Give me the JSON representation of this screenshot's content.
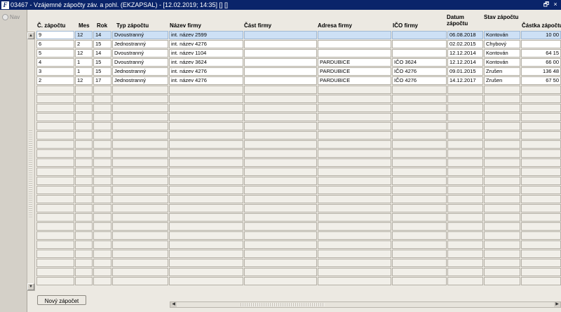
{
  "window": {
    "title": "03467 - Vzájemné zápočty záv. a pohl. (EKZAPSAL) - [12.02.2019; 14:35] [] []",
    "restore_glyph": "🗗",
    "close_glyph": "×"
  },
  "nav": {
    "label": "Nav"
  },
  "columns": [
    {
      "key": "zapocet",
      "label": "Č. zápočtu"
    },
    {
      "key": "mes",
      "label": "Mes"
    },
    {
      "key": "rok",
      "label": "Rok"
    },
    {
      "key": "typ",
      "label": "Typ zápočtu"
    },
    {
      "key": "nazev",
      "label": "Název firmy"
    },
    {
      "key": "cast",
      "label": "Část firmy"
    },
    {
      "key": "adresa",
      "label": "Adresa firmy"
    },
    {
      "key": "ico",
      "label": "IČO firmy"
    },
    {
      "key": "datum",
      "label": "Datum zápočtu"
    },
    {
      "key": "stav",
      "label": "Stav zápočtu"
    },
    {
      "key": "castka",
      "label": "Částka zápočtu"
    }
  ],
  "rows": [
    {
      "zapocet": "9",
      "mes": "12",
      "rok": "14",
      "typ": "Dvoustranný",
      "nazev": "int. název 2599",
      "cast": "",
      "adresa": "",
      "ico": "",
      "datum": "06.08.2018",
      "stav": "Kontován",
      "castka": "10 00"
    },
    {
      "zapocet": "6",
      "mes": "2",
      "rok": "15",
      "typ": "Jednostranný",
      "nazev": "int. název 4276",
      "cast": "",
      "adresa": "",
      "ico": "",
      "datum": "02.02.2015",
      "stav": "Chybový",
      "castka": ""
    },
    {
      "zapocet": "5",
      "mes": "12",
      "rok": "14",
      "typ": "Dvoustranný",
      "nazev": "int. název 1104",
      "cast": "",
      "adresa": "",
      "ico": "",
      "datum": "12.12.2014",
      "stav": "Kontován",
      "castka": "64 15"
    },
    {
      "zapocet": "4",
      "mes": "1",
      "rok": "15",
      "typ": "Dvoustranný",
      "nazev": "int. název 3624",
      "cast": "",
      "adresa": "PARDUBICE",
      "ico": "IČO 3624",
      "datum": "12.12.2014",
      "stav": "Kontován",
      "castka": "66 00"
    },
    {
      "zapocet": "3",
      "mes": "1",
      "rok": "15",
      "typ": "Jednostranný",
      "nazev": "int. název 4276",
      "cast": "",
      "adresa": "PARDUBICE",
      "ico": "IČO 4276",
      "datum": "09.01.2015",
      "stav": "Zrušen",
      "castka": "136 48"
    },
    {
      "zapocet": "2",
      "mes": "12",
      "rok": "17",
      "typ": "Jednostranný",
      "nazev": "int. název 4276",
      "cast": "",
      "adresa": "PARDUBICE",
      "ico": "IČO 4276",
      "datum": "14.12.2017",
      "stav": "Zrušen",
      "castka": "67 50"
    }
  ],
  "buttons": {
    "new_zapocet": "Nový zápočet"
  }
}
